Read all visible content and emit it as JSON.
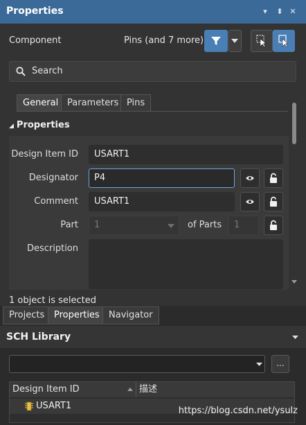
{
  "title": "Properties",
  "title_buttons": [
    "▾",
    "⬍",
    "✕"
  ],
  "header": {
    "component_label": "Component",
    "filter_summary": "Pins (and 7 more)"
  },
  "search": {
    "placeholder": "Search"
  },
  "tabs": [
    {
      "label": "General",
      "active": true
    },
    {
      "label": "Parameters",
      "active": false
    },
    {
      "label": "Pins",
      "active": false
    }
  ],
  "section": {
    "title": "Properties"
  },
  "fields": {
    "design_item_id": {
      "label": "Design Item ID",
      "value": "USART1"
    },
    "designator": {
      "label": "Designator",
      "value": "P4"
    },
    "comment": {
      "label": "Comment",
      "value": "USART1"
    },
    "part": {
      "label": "Part",
      "value": "1",
      "of_parts_label": "of Parts",
      "of_parts_value": "1"
    },
    "description": {
      "label": "Description",
      "value": ""
    }
  },
  "status": "1 object is selected",
  "bottom_tabs": [
    {
      "label": "Projects",
      "active": false
    },
    {
      "label": "Properties",
      "active": true
    },
    {
      "label": "Navigator",
      "active": false
    }
  ],
  "sch_library": {
    "title": "SCH Library",
    "combo_value": "",
    "more_button": "...",
    "columns": [
      "Design Item ID",
      "描述"
    ],
    "rows": [
      {
        "id": "USART1",
        "desc": ""
      }
    ]
  },
  "watermark": "https://blog.csdn.net/ysulz",
  "colors": {
    "title_bar": "#3c6a98",
    "accent_button": "#4a7fb5",
    "focus_border": "#6ea6dd",
    "panel_bg": "#333333"
  },
  "icons": [
    "filter-icon",
    "select-cursor-icon",
    "select-arrow-icon",
    "search-icon",
    "eye-icon",
    "lock-icon",
    "component-icon"
  ]
}
